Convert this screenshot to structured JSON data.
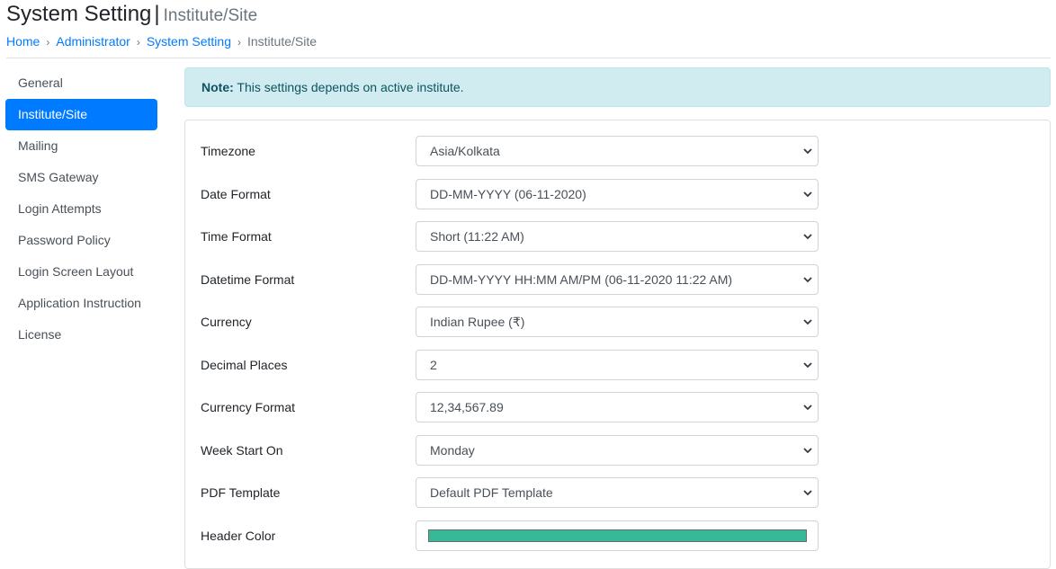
{
  "header": {
    "title": "System Setting",
    "separator": "|",
    "subtitle": "Institute/Site"
  },
  "breadcrumb": {
    "items": [
      {
        "label": "Home",
        "link": true
      },
      {
        "label": "Administrator",
        "link": true
      },
      {
        "label": "System Setting",
        "link": true
      },
      {
        "label": "Institute/Site",
        "link": false
      }
    ],
    "separator": "›"
  },
  "sidebar": {
    "items": [
      {
        "label": "General",
        "active": false
      },
      {
        "label": "Institute/Site",
        "active": true
      },
      {
        "label": "Mailing",
        "active": false
      },
      {
        "label": "SMS Gateway",
        "active": false
      },
      {
        "label": "Login Attempts",
        "active": false
      },
      {
        "label": "Password Policy",
        "active": false
      },
      {
        "label": "Login Screen Layout",
        "active": false
      },
      {
        "label": "Application Instruction",
        "active": false
      },
      {
        "label": "License",
        "active": false
      }
    ]
  },
  "note": {
    "prefix": "Note:",
    "text": " This settings depends on active institute."
  },
  "form": {
    "fields": [
      {
        "label": "Timezone",
        "value": "Asia/Kolkata"
      },
      {
        "label": "Date Format",
        "value": "DD-MM-YYYY (06-11-2020)"
      },
      {
        "label": "Time Format",
        "value": "Short (11:22 AM)"
      },
      {
        "label": "Datetime Format",
        "value": "DD-MM-YYYY HH:MM AM/PM (06-11-2020 11:22 AM)"
      },
      {
        "label": "Currency",
        "value": "Indian Rupee (₹)"
      },
      {
        "label": "Decimal Places",
        "value": "2"
      },
      {
        "label": "Currency Format",
        "value": "12,34,567.89"
      },
      {
        "label": "Week Start On",
        "value": "Monday"
      },
      {
        "label": "PDF Template",
        "value": "Default PDF Template"
      }
    ],
    "header_color": {
      "label": "Header Color",
      "value": "#36b997"
    }
  },
  "colors": {
    "primary": "#007bff",
    "alert_bg": "#d1ecf1",
    "alert_text": "#0c5460"
  }
}
